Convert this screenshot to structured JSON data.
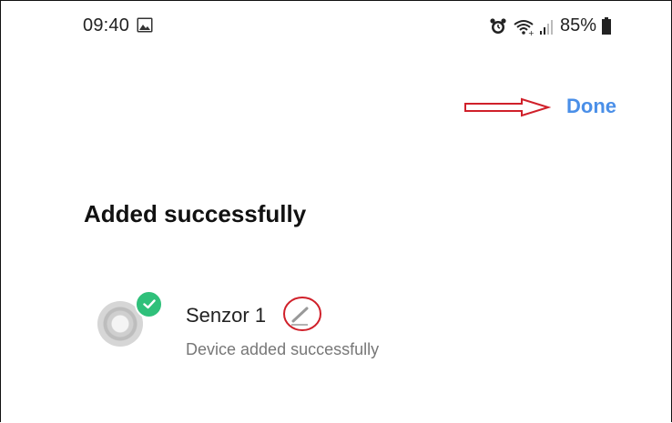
{
  "status_bar": {
    "time": "09:40",
    "battery_percent": "85%",
    "icons": [
      "gallery-icon",
      "alarm-icon",
      "wifi-icon",
      "signal-icon",
      "battery-icon"
    ]
  },
  "header": {
    "done_label": "Done",
    "annotation": "red-arrow-pointing-to-done"
  },
  "main": {
    "title": "Added successfully",
    "device": {
      "name": "Senzor 1",
      "status": "Device added successfully",
      "badge": "check-icon",
      "edit": "pencil-icon"
    }
  },
  "colors": {
    "accent": "#4a8fe8",
    "success": "#2fc07a",
    "annotation": "#d0202a"
  }
}
